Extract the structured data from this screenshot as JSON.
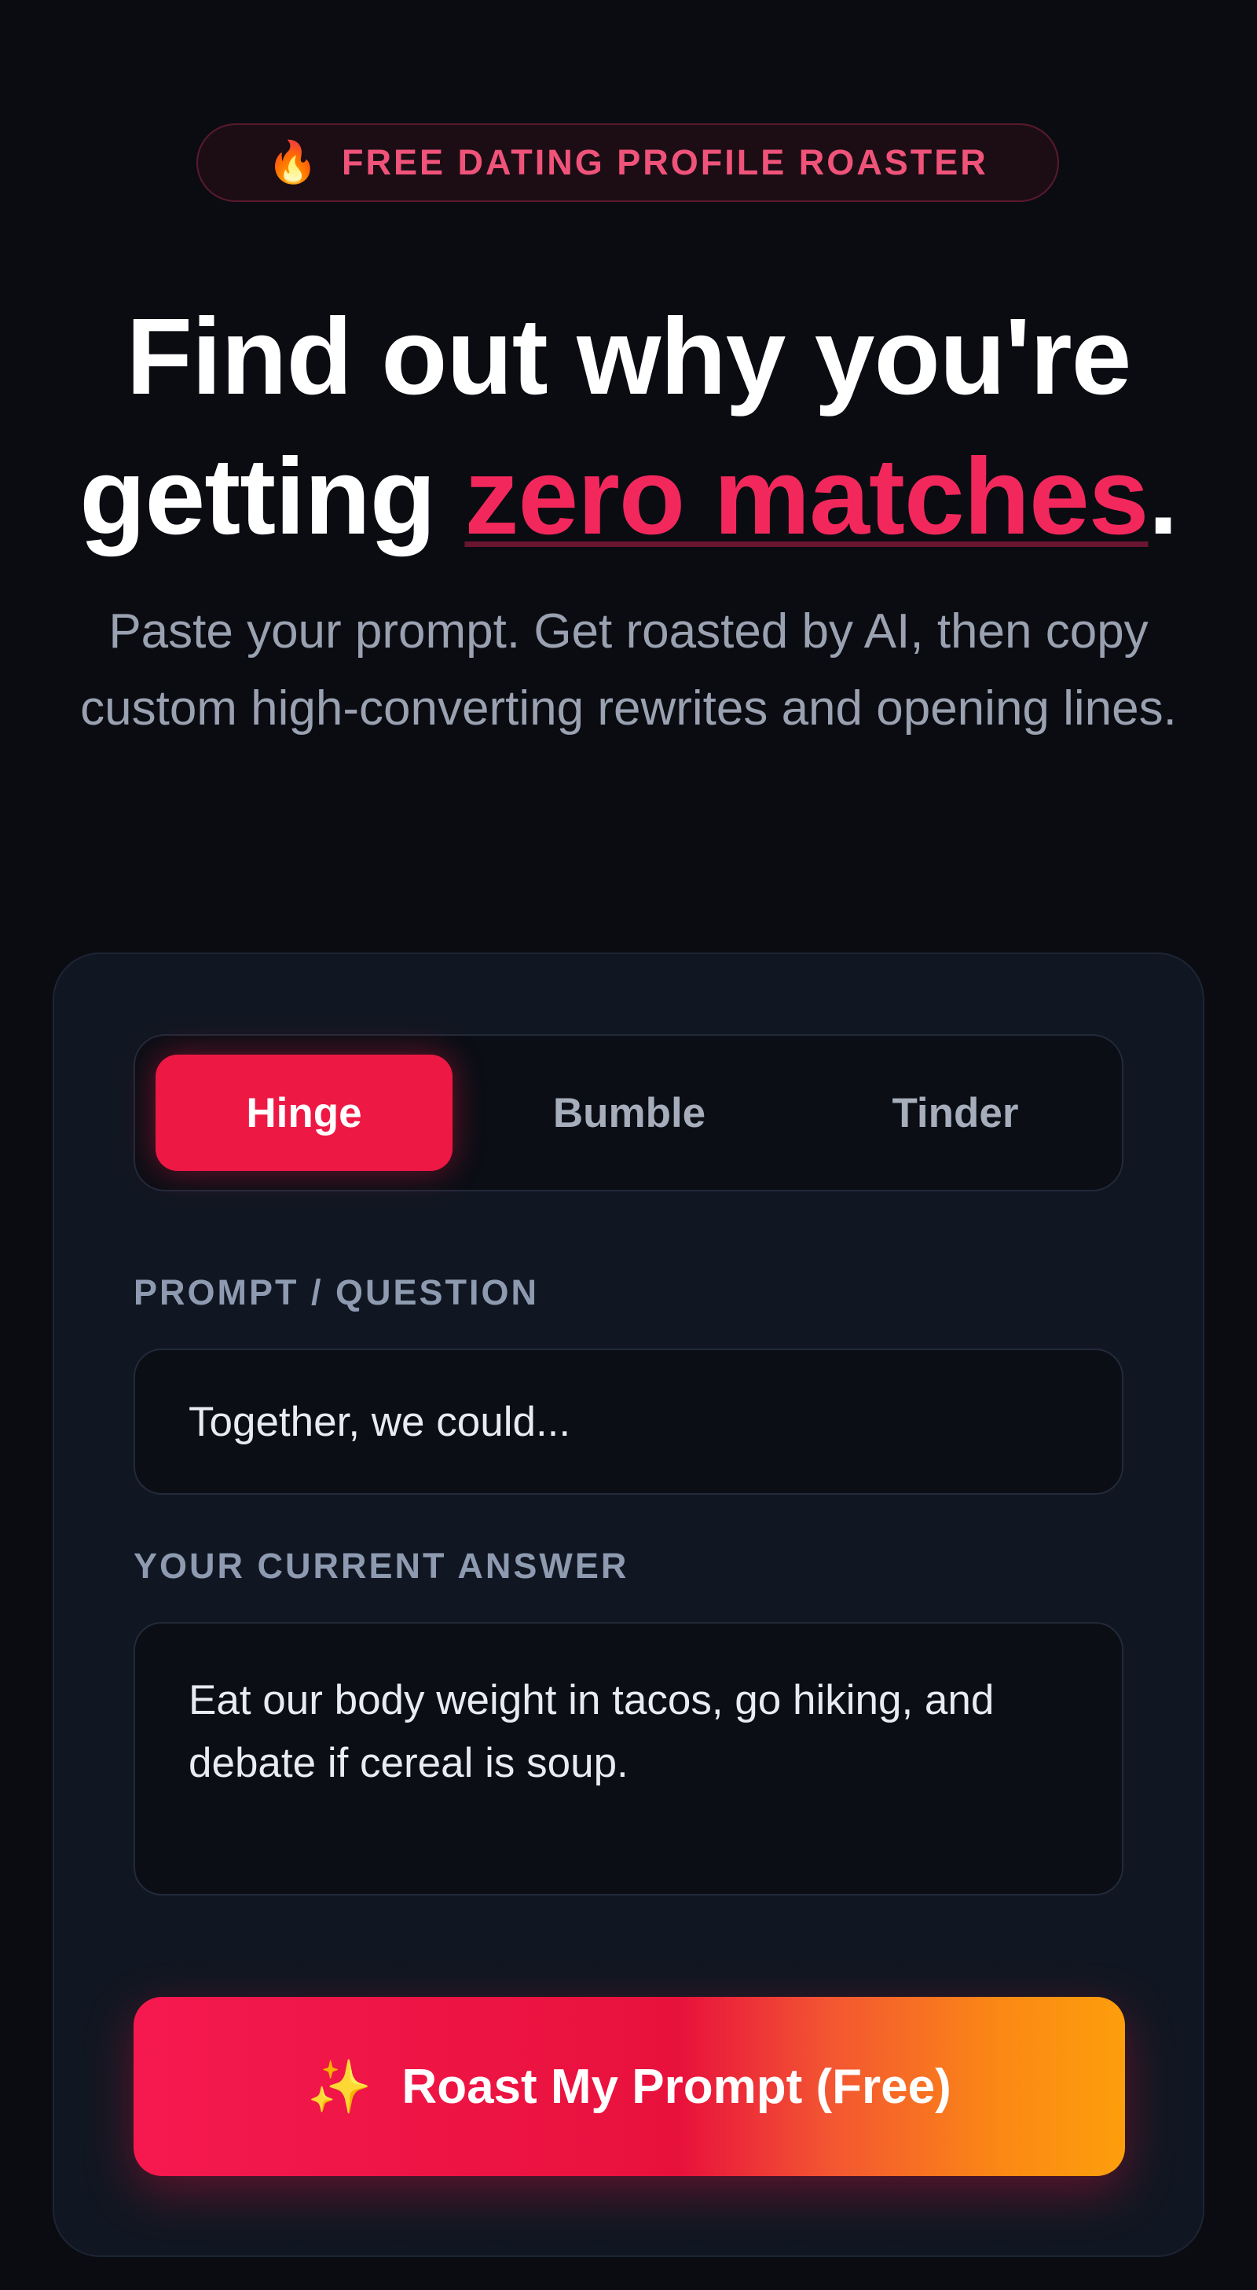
{
  "badge": {
    "icon": "fire-icon",
    "text": "FREE DATING PROFILE ROASTER"
  },
  "headline": {
    "line1": "Find out why you're",
    "line2_prefix": "getting ",
    "accent": "zero matches",
    "suffix": "."
  },
  "subtitle": "Paste your prompt. Get roasted by AI, then copy custom high-converting rewrites and opening lines.",
  "platforms": {
    "tabs": [
      {
        "label": "Hinge",
        "active": true
      },
      {
        "label": "Bumble",
        "active": false
      },
      {
        "label": "Tinder",
        "active": false
      }
    ]
  },
  "form": {
    "prompt_label": "PROMPT / QUESTION",
    "prompt_value": "Together, we could...",
    "answer_label": "YOUR CURRENT ANSWER",
    "answer_value": "Eat our body weight in tacos, go hiking, and debate if cereal is soup."
  },
  "cta": {
    "icon": "sparkles-icon",
    "label": "Roast My Prompt (Free)"
  },
  "colors": {
    "background": "#0a0c12",
    "accent": "#f2285c",
    "active_tab": "#ee1845",
    "cta_gradient_end": "#fd9e0c"
  }
}
